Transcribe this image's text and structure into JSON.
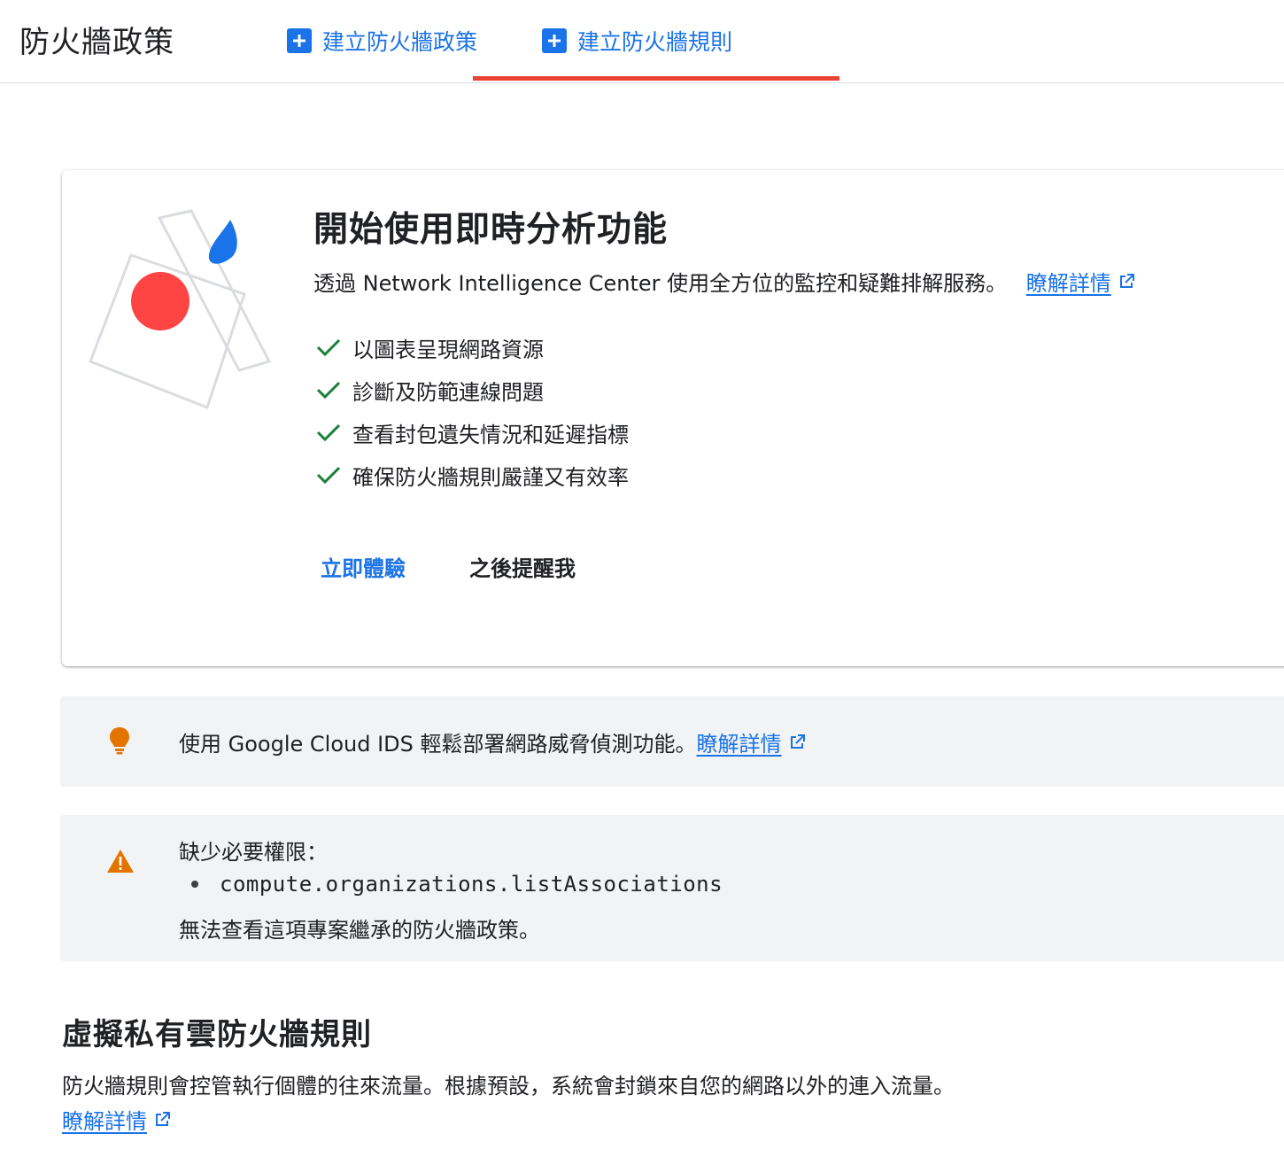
{
  "header": {
    "title": "防火牆政策",
    "create_policy_label": "建立防火牆政策",
    "create_rule_label": "建立防火牆規則"
  },
  "card": {
    "title": "開始使用即時分析功能",
    "description": "透過 Network Intelligence Center 使用全方位的監控和疑難排解服務。",
    "learn_more": "瞭解詳情",
    "features": [
      "以圖表呈現網路資源",
      "診斷及防範連線問題",
      "查看封包遺失情況和延遲指標",
      "確保防火牆規則嚴謹又有效率"
    ],
    "try_now_label": "立即體驗",
    "remind_later_label": "之後提醒我"
  },
  "tip_banner": {
    "text": "使用 Google Cloud IDS 輕鬆部署網路威脅偵測功能。",
    "learn_more": "瞭解詳情"
  },
  "warning_banner": {
    "title": "缺少必要權限：",
    "permission": "compute.organizations.listAssociations",
    "note": "無法查看這項專案繼承的防火牆政策。"
  },
  "vpc_section": {
    "title": "虛擬私有雲防火牆規則",
    "description": "防火牆規則會控管執行個體的往來流量。根據預設，系統會封鎖來自您的網路以外的連入流量。",
    "learn_more": "瞭解詳情"
  },
  "colors": {
    "accent_blue": "#1a73e8",
    "active_tab_red": "#ea4335",
    "check_green": "#188038",
    "tip_orange": "#e37400",
    "warn_orange": "#e37400"
  }
}
